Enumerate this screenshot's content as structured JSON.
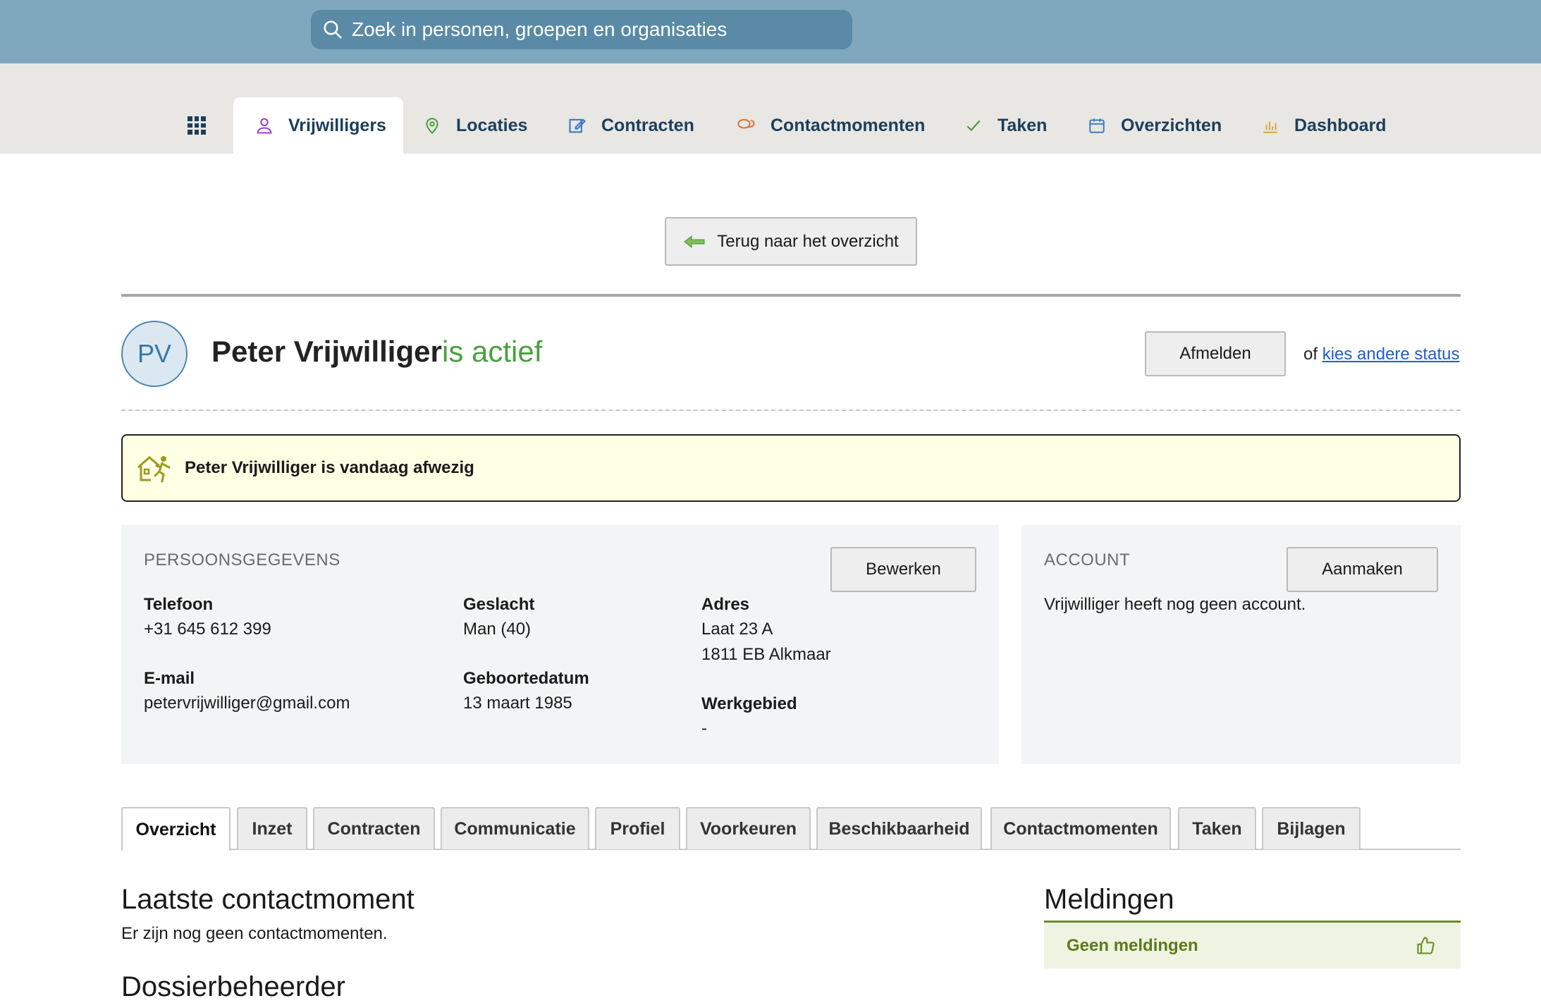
{
  "search": {
    "placeholder": "Zoek in personen, groepen en organisaties"
  },
  "nav": {
    "items": [
      {
        "label": "Vrijwilligers",
        "icon": "person-icon",
        "active": true
      },
      {
        "label": "Locaties",
        "icon": "location-pin-icon"
      },
      {
        "label": "Contracten",
        "icon": "contract-edit-icon"
      },
      {
        "label": "Contactmomenten",
        "icon": "chat-bubbles-icon"
      },
      {
        "label": "Taken",
        "icon": "checkmark-icon"
      },
      {
        "label": "Overzichten",
        "icon": "calendar-icon"
      },
      {
        "label": "Dashboard",
        "icon": "bar-chart-icon"
      }
    ]
  },
  "back_button": {
    "label": "Terug naar het overzicht"
  },
  "person": {
    "initials": "PV",
    "name": "Peter Vrijwilliger",
    "status": "is actief",
    "status_color": "#49a040",
    "unsubscribe_label": "Afmelden",
    "or_text": "of",
    "other_status_link": "kies andere status"
  },
  "alert": {
    "text": "Peter Vrijwilliger is vandaag afwezig",
    "icon": "absent-person-icon"
  },
  "personal": {
    "title": "PERSOONSGEGEVENS",
    "edit_label": "Bewerken",
    "phone_label": "Telefoon",
    "phone": "+31 645 612 399",
    "email_label": "E-mail",
    "email": "petervrijwilliger@gmail.com",
    "gender_label": "Geslacht",
    "gender": "Man (40)",
    "birthdate_label": "Geboortedatum",
    "birthdate": "13 maart 1985",
    "address_label": "Adres",
    "address_line1": "Laat 23 A",
    "address_line2": "1811 EB Alkmaar",
    "area_label": "Werkgebied",
    "area": "-"
  },
  "account": {
    "title": "ACCOUNT",
    "create_label": "Aanmaken",
    "text": "Vrijwilliger heeft nog geen account."
  },
  "tabs": [
    "Overzicht",
    "Inzet",
    "Contracten",
    "Communicatie",
    "Profiel",
    "Voorkeuren",
    "Beschikbaarheid",
    "Contactmomenten",
    "Taken",
    "Bijlagen"
  ],
  "overview": {
    "last_contact_title": "Laatste contactmoment",
    "last_contact_text": "Er zijn nog geen contactmomenten.",
    "dossier_title": "Dossierbeheerder",
    "notifications_title": "Meldingen",
    "notifications_text": "Geen meldingen"
  }
}
